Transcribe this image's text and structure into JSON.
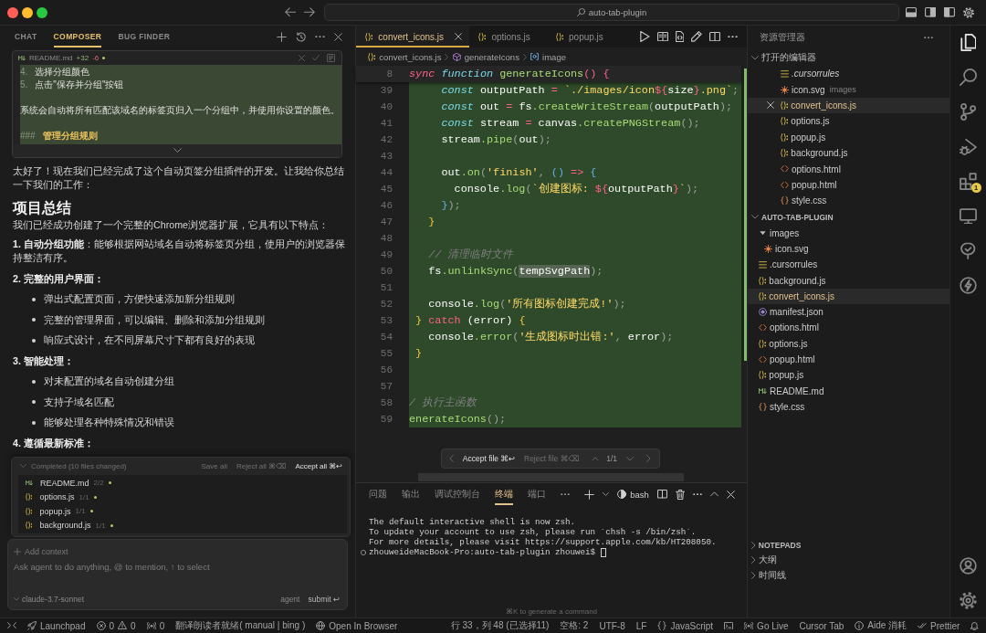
{
  "window": {
    "title": "auto-tab-plugin"
  },
  "composer": {
    "tabs": [
      {
        "label": "CHAT",
        "selected": false
      },
      {
        "label": "COMPOSER",
        "selected": true
      },
      {
        "label": "BUG FINDER",
        "selected": false
      }
    ],
    "diff_card": {
      "file": "README.md",
      "added": "+32",
      "removed": "-6",
      "lines": [
        {
          "kind": "list",
          "marker": "4.",
          "text": "选择分组颜色"
        },
        {
          "kind": "list",
          "marker": "5.",
          "text": "点击\"保存并分组\"按钮"
        },
        {
          "kind": "blank"
        },
        {
          "kind": "text",
          "text": "系统会自动将所有匹配该域名的标签页归入一个分组中，并使用你设置的颜色。"
        },
        {
          "kind": "blank"
        },
        {
          "kind": "heading",
          "marker": "###",
          "text": "管理分组规则"
        }
      ]
    },
    "message": {
      "intro": "太好了！现在我们已经完成了这个自动页签分组插件的开发。让我给你总结一下我们的工作：",
      "heading": "项目总结",
      "lead": "我们已经成功创建了一个完整的Chrome浏览器扩展，它具有以下特点：",
      "blocks": [
        {
          "kind": "paragraph",
          "text": "**1. 自动分组功能**：能够根据网站域名自动将标签页分组，使用户的浏览器保持整洁有序。"
        },
        {
          "kind": "label",
          "text": "2. 完整的用户界面："
        },
        {
          "kind": "bullet",
          "text": "弹出式配置页面，方便快速添加新分组规则"
        },
        {
          "kind": "bullet",
          "text": "完整的管理界面，可以编辑、删除和添加分组规则"
        },
        {
          "kind": "bullet",
          "text": "响应式设计，在不同屏幕尺寸下都有良好的表现"
        },
        {
          "kind": "label",
          "text": "3. 智能处理："
        },
        {
          "kind": "bullet",
          "text": "对未配置的域名自动创建分组"
        },
        {
          "kind": "bullet",
          "text": "支持子域名匹配"
        },
        {
          "kind": "bullet",
          "text": "能够处理各种特殊情况和错误"
        },
        {
          "kind": "label",
          "text": "4. 遵循最新标准："
        }
      ]
    },
    "changes": {
      "summary": "Completed (10 files changed)",
      "expanded": true,
      "actions": [
        {
          "label": "Save all",
          "primary": false
        },
        {
          "label": "Reject all ⌘⌫",
          "primary": false
        },
        {
          "label": "Accept all ⌘↩",
          "primary": true
        }
      ],
      "files": [
        {
          "name": "README.md",
          "kind": "markdown",
          "count": "2/2"
        },
        {
          "name": "options.js",
          "kind": "js",
          "count": "1/1"
        },
        {
          "name": "popup.js",
          "kind": "js",
          "count": "1/1"
        },
        {
          "name": "background.js",
          "kind": "js",
          "count": "1/1"
        }
      ]
    },
    "input": {
      "add_context": "Add context",
      "placeholder": "Ask agent to do anything, @ to mention, ↑ to select",
      "model": "claude-3.7-sonnet",
      "mode": "agent",
      "submit": "submit ↩"
    }
  },
  "editor": {
    "tabs": [
      {
        "label": "convert_icons.js",
        "selected": true
      },
      {
        "label": "options.js",
        "selected": false
      },
      {
        "label": "popup.js",
        "selected": false
      }
    ],
    "breadcrumb": [
      {
        "kind": "file",
        "label": "convert_icons.js"
      },
      {
        "kind": "function",
        "label": "generateIcons"
      },
      {
        "kind": "variable",
        "label": "image"
      }
    ],
    "sticky_line": {
      "number": "8",
      "tokens": [
        {
          "kind": "storage",
          "text": "sync"
        },
        {
          "kind": "keyword",
          "text": " function"
        },
        {
          "kind": "function",
          "text": " generateIcons"
        },
        {
          "kind": "operator",
          "text": "() {"
        }
      ]
    },
    "lines": [
      {
        "number": "39",
        "added": true,
        "tokens": [
          {
            "kind": "keyword",
            "text": "     const"
          },
          {
            "kind": "text",
            "text": " outputPath "
          },
          {
            "kind": "operator",
            "text": "="
          },
          {
            "kind": "string",
            "text": " `./images/icon"
          },
          {
            "kind": "operator",
            "text": "${"
          },
          {
            "kind": "text",
            "text": "size"
          },
          {
            "kind": "operator",
            "text": "}"
          },
          {
            "kind": "string",
            "text": ".png`"
          },
          {
            "kind": "punct",
            "text": ";"
          }
        ]
      },
      {
        "number": "40",
        "added": true,
        "tokens": [
          {
            "kind": "keyword",
            "text": "     const"
          },
          {
            "kind": "text",
            "text": " out "
          },
          {
            "kind": "operator",
            "text": "="
          },
          {
            "kind": "text",
            "text": " fs"
          },
          {
            "kind": "function",
            "text": ".createWriteStream"
          },
          {
            "kind": "punct",
            "text": "("
          },
          {
            "kind": "text",
            "text": "outputPath"
          },
          {
            "kind": "punct",
            "text": ");"
          }
        ]
      },
      {
        "number": "41",
        "added": true,
        "tokens": [
          {
            "kind": "keyword",
            "text": "     const"
          },
          {
            "kind": "text",
            "text": " stream "
          },
          {
            "kind": "operator",
            "text": "="
          },
          {
            "kind": "text",
            "text": " canvas"
          },
          {
            "kind": "function",
            "text": ".createPNGStream"
          },
          {
            "kind": "punct",
            "text": "();"
          }
        ]
      },
      {
        "number": "42",
        "added": true,
        "tokens": [
          {
            "kind": "text",
            "text": "     stream"
          },
          {
            "kind": "function",
            "text": ".pipe"
          },
          {
            "kind": "punct",
            "text": "("
          },
          {
            "kind": "text",
            "text": "out"
          },
          {
            "kind": "punct",
            "text": ");"
          }
        ]
      },
      {
        "number": "43",
        "added": true
      },
      {
        "number": "44",
        "added": true,
        "tokens": [
          {
            "kind": "text",
            "text": "     out"
          },
          {
            "kind": "function",
            "text": ".on"
          },
          {
            "kind": "punct",
            "text": "("
          },
          {
            "kind": "string",
            "text": "'finish'"
          },
          {
            "kind": "punct",
            "text": ","
          },
          {
            "kind": "bracket_blue",
            "text": " ()"
          },
          {
            "kind": "operator",
            "text": " =>"
          },
          {
            "kind": "bracket_blue",
            "text": " {"
          }
        ]
      },
      {
        "number": "45",
        "added": true,
        "tokens": [
          {
            "kind": "text",
            "text": "       console"
          },
          {
            "kind": "function",
            "text": ".log"
          },
          {
            "kind": "punct",
            "text": "("
          },
          {
            "kind": "string",
            "text": "`创建图标: "
          },
          {
            "kind": "operator",
            "text": "${"
          },
          {
            "kind": "text",
            "text": "outputPath"
          },
          {
            "kind": "operator",
            "text": "}"
          },
          {
            "kind": "string",
            "text": "`"
          },
          {
            "kind": "punct",
            "text": ");"
          }
        ]
      },
      {
        "number": "46",
        "added": true,
        "tokens": [
          {
            "kind": "bracket_blue",
            "text": "     }"
          },
          {
            "kind": "punct",
            "text": ");"
          }
        ]
      },
      {
        "number": "47",
        "added": true,
        "tokens": [
          {
            "kind": "bracket_gold",
            "text": "   }"
          }
        ]
      },
      {
        "number": "48",
        "added": true
      },
      {
        "number": "49",
        "added": true,
        "tokens": [
          {
            "kind": "comment",
            "text": "   // 清理临时文件"
          }
        ]
      },
      {
        "number": "50",
        "added": true,
        "tokens": [
          {
            "kind": "text",
            "text": "   fs"
          },
          {
            "kind": "function",
            "text": ".unlinkSync"
          },
          {
            "kind": "punct",
            "text": "("
          },
          {
            "kind": "match",
            "text": "tempSvgPath"
          },
          {
            "kind": "punct",
            "text": ");"
          }
        ]
      },
      {
        "number": "51",
        "added": true
      },
      {
        "number": "52",
        "added": true,
        "tokens": [
          {
            "kind": "text",
            "text": "   console"
          },
          {
            "kind": "function",
            "text": ".log"
          },
          {
            "kind": "punct",
            "text": "("
          },
          {
            "kind": "string",
            "text": "'所有图标创建完成!'"
          },
          {
            "kind": "punct",
            "text": ");"
          }
        ]
      },
      {
        "number": "53",
        "added": true,
        "tokens": [
          {
            "kind": "bracket_gold",
            "text": " }"
          },
          {
            "kind": "operator",
            "text": " catch"
          },
          {
            "kind": "text",
            "text": " (error) "
          },
          {
            "kind": "bracket_gold",
            "text": "{"
          }
        ]
      },
      {
        "number": "54",
        "added": true,
        "tokens": [
          {
            "kind": "text",
            "text": "   console"
          },
          {
            "kind": "function",
            "text": ".error"
          },
          {
            "kind": "punct",
            "text": "("
          },
          {
            "kind": "string",
            "text": "'生成图标时出错:'"
          },
          {
            "kind": "punct",
            "text": ","
          },
          {
            "kind": "text",
            "text": " error"
          },
          {
            "kind": "punct",
            "text": ");"
          }
        ]
      },
      {
        "number": "55",
        "added": true,
        "tokens": [
          {
            "kind": "bracket_gold",
            "text": " }"
          }
        ]
      },
      {
        "number": "56",
        "added": true
      },
      {
        "number": "57",
        "added": true
      },
      {
        "number": "58",
        "added": true,
        "tokens": [
          {
            "kind": "comment",
            "text": "/ 执行主函数"
          }
        ]
      },
      {
        "number": "59",
        "added": true,
        "tokens": [
          {
            "kind": "function",
            "text": "enerateIcons"
          },
          {
            "kind": "punct",
            "text": "();"
          }
        ]
      }
    ],
    "review_bar": {
      "accept": "Accept file ⌘↩",
      "reject": "Reject file ⌘⌫",
      "position": "1/1"
    }
  },
  "panel": {
    "tabs": [
      {
        "label": "问题",
        "selected": false
      },
      {
        "label": "输出",
        "selected": false
      },
      {
        "label": "调试控制台",
        "selected": false
      },
      {
        "label": "终端",
        "selected": true
      },
      {
        "label": "端口",
        "selected": false
      }
    ],
    "shell": "bash",
    "output": [
      "The default interactive shell is now zsh.",
      "To update your account to use zsh, please run `chsh -s /bin/zsh`.",
      "For more details, please visit https://support.apple.com/kb/HT208050."
    ],
    "prompt": "zhouweideMacBook-Pro:auto-tab-plugin zhouwei$",
    "hint": "⌘K to generate a command"
  },
  "explorer": {
    "title": "资源管理器",
    "open_editors": {
      "title": "打开的编辑器",
      "expanded": true,
      "items": [
        {
          "name": ".cursorrules",
          "kind": "rules",
          "selected": false,
          "preview": true
        },
        {
          "name": "icon.svg",
          "kind": "svg",
          "folder": "images",
          "selected": false,
          "preview": false
        },
        {
          "name": "convert_icons.js",
          "kind": "js",
          "selected": true,
          "preview": false
        },
        {
          "name": "options.js",
          "kind": "js",
          "selected": false,
          "preview": false
        },
        {
          "name": "popup.js",
          "kind": "js",
          "selected": false,
          "preview": false
        },
        {
          "name": "background.js",
          "kind": "js",
          "selected": false,
          "preview": false
        },
        {
          "name": "options.html",
          "kind": "html",
          "selected": false,
          "preview": false
        },
        {
          "name": "popup.html",
          "kind": "html",
          "selected": false,
          "preview": false
        },
        {
          "name": "style.css",
          "kind": "css",
          "selected": false,
          "preview": false
        }
      ]
    },
    "project": {
      "title": "AUTO-TAB-PLUGIN",
      "expanded": true,
      "tree": [
        {
          "name": "images",
          "kind": "folder",
          "expanded": true,
          "selected": false,
          "children": [
            {
              "name": "icon.svg",
              "kind": "svg",
              "selected": false
            }
          ]
        },
        {
          "name": ".cursorrules",
          "kind": "rules",
          "selected": false
        },
        {
          "name": "background.js",
          "kind": "js",
          "selected": false
        },
        {
          "name": "convert_icons.js",
          "kind": "js",
          "selected": true
        },
        {
          "name": "manifest.json",
          "kind": "json",
          "selected": false
        },
        {
          "name": "options.html",
          "kind": "html",
          "selected": false
        },
        {
          "name": "options.js",
          "kind": "js",
          "selected": false
        },
        {
          "name": "popup.html",
          "kind": "html",
          "selected": false
        },
        {
          "name": "popup.js",
          "kind": "js",
          "selected": false
        },
        {
          "name": "README.md",
          "kind": "markdown",
          "selected": false
        },
        {
          "name": "style.css",
          "kind": "css",
          "selected": false
        }
      ]
    },
    "collapsed_sections": [
      {
        "title": "NOTEPADS",
        "expanded": false
      },
      {
        "title": "大纲",
        "expanded": false
      },
      {
        "title": "时间线",
        "expanded": false
      }
    ]
  },
  "activity_bar": {
    "items": [
      {
        "kind": "files",
        "selected": true
      },
      {
        "kind": "search",
        "selected": false
      },
      {
        "kind": "source-control",
        "selected": false
      },
      {
        "kind": "run-debug",
        "selected": false
      },
      {
        "kind": "extensions",
        "selected": false,
        "badge": "1"
      },
      {
        "kind": "remote",
        "selected": false
      },
      {
        "kind": "tree",
        "selected": false
      },
      {
        "kind": "lightning",
        "selected": false
      }
    ],
    "bottom": [
      {
        "kind": "account"
      },
      {
        "kind": "settings"
      }
    ]
  },
  "status_bar": {
    "left": [
      {
        "kind": "remote"
      },
      {
        "kind": "rocket",
        "text": "Launchpad"
      },
      {
        "kind": "problems",
        "errors": "0",
        "warnings": "0"
      },
      {
        "kind": "broadcast",
        "text": "0"
      },
      {
        "kind": "plain",
        "text": "翻译朗读者就绪( manual | bing )"
      },
      {
        "kind": "globe",
        "text": "Open In Browser"
      }
    ],
    "right": [
      {
        "kind": "plain",
        "text": "行 33，列 48 (已选择11)"
      },
      {
        "kind": "plain",
        "text": "空格: 2"
      },
      {
        "kind": "plain",
        "text": "UTF-8"
      },
      {
        "kind": "plain",
        "text": "LF"
      },
      {
        "kind": "braces",
        "text": "JavaScript"
      },
      {
        "kind": "terminal"
      },
      {
        "kind": "radio",
        "text": "Go Live"
      },
      {
        "kind": "plain",
        "text": "Cursor Tab"
      },
      {
        "kind": "info",
        "text": "Aide 消耗"
      },
      {
        "kind": "double-check",
        "text": "Prettier"
      },
      {
        "kind": "bell"
      }
    ]
  }
}
